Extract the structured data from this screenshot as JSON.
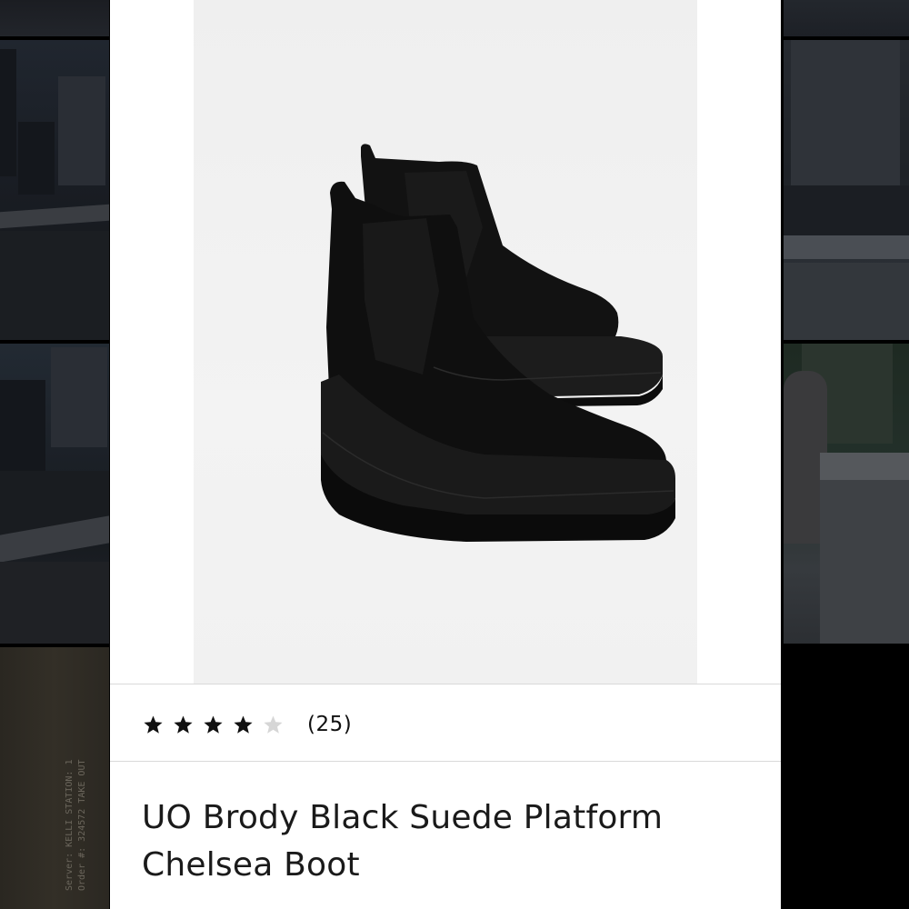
{
  "product": {
    "title": "UO Brody Black Suede Platform Chelsea Boot",
    "rating_value": 4,
    "rating_max": 5,
    "review_count_text": "(25)",
    "image_icon": "black-platform-chelsea-boots-photo"
  },
  "background_tiles": {
    "receipt_lines": [
      "Server: KELLI   STATION: 1",
      "Order #: 324572   TAKE OUT"
    ]
  },
  "colors": {
    "star_filled": "#111111",
    "star_empty": "#d6d6d6",
    "card_background": "#ffffff",
    "page_background": "#000000"
  }
}
